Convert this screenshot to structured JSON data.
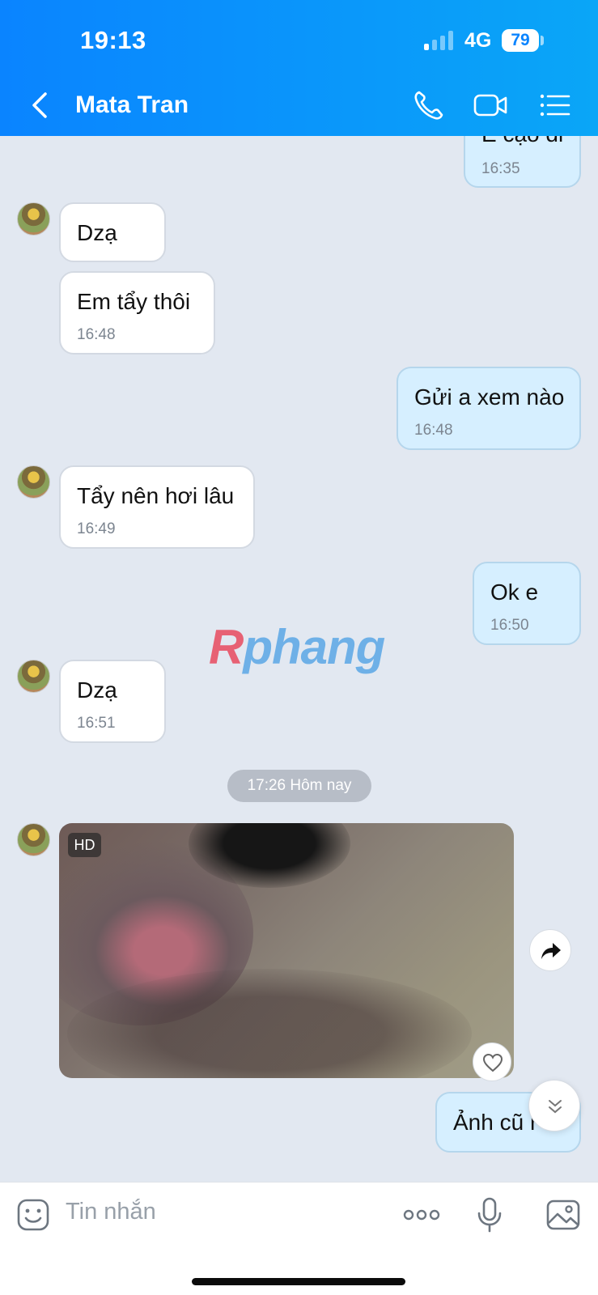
{
  "status_bar": {
    "time": "19:13",
    "network": "4G",
    "battery": "79"
  },
  "header": {
    "title": "Mata Tran"
  },
  "messages": {
    "m0": {
      "text": "E cạo đi",
      "time": "16:35"
    },
    "m1": {
      "text": "Dzạ"
    },
    "m2": {
      "text": "Em tẩy thôi",
      "time": "16:48"
    },
    "m3": {
      "text": "Gửi a xem nào",
      "time": "16:48"
    },
    "m4": {
      "text": "Tẩy nên hơi lâu",
      "time": "16:49"
    },
    "m5": {
      "text": "Ok e",
      "time": "16:50"
    },
    "m6": {
      "text": "Dzạ",
      "time": "16:51"
    },
    "m7": {
      "text": "Ảnh cũ r"
    }
  },
  "date_separator": "17:26 Hôm nay",
  "media": {
    "badge": "HD"
  },
  "watermark": {
    "part1": "R",
    "part2": "phang"
  },
  "composer": {
    "placeholder": "Tin nhắn"
  }
}
